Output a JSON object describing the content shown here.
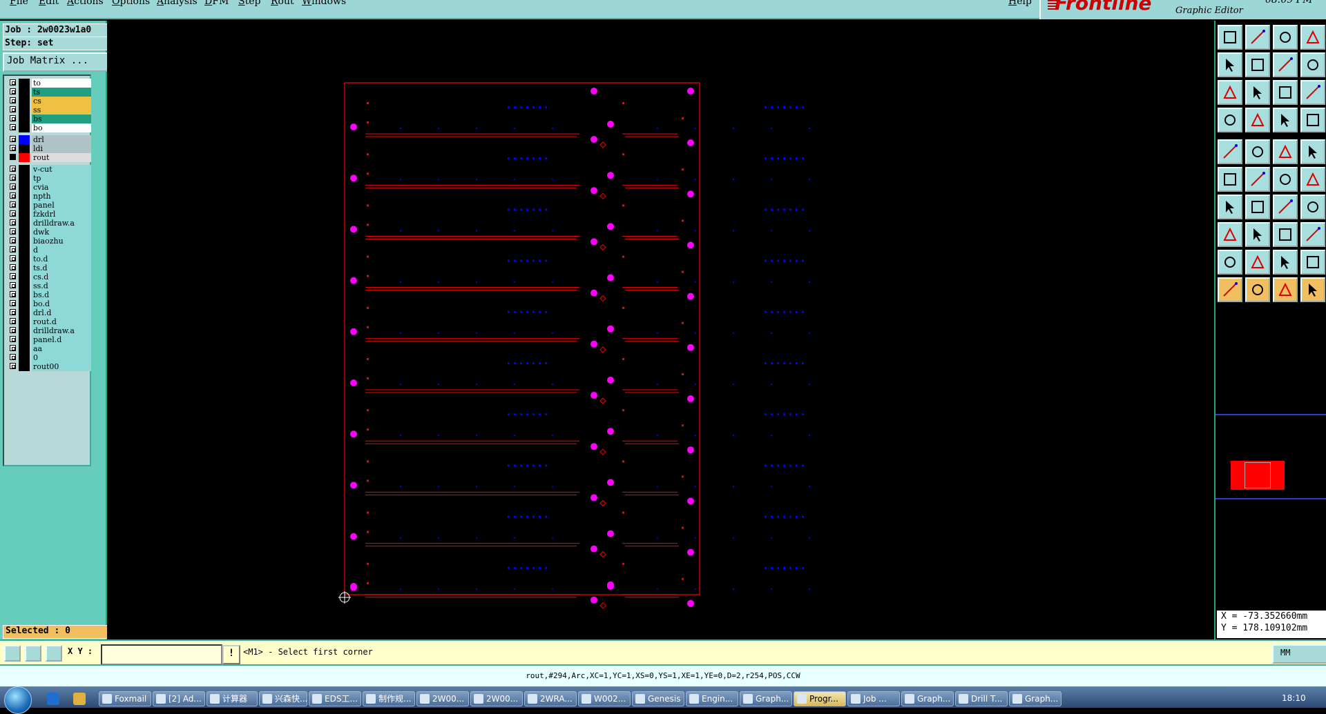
{
  "menubar": {
    "items": [
      "File",
      "Edit",
      "Actions",
      "Options",
      "Analysis",
      "DFM",
      "Step",
      "Rout",
      "Windows"
    ],
    "help": "Help",
    "brand": "Frontline",
    "subtitle": "Graphic Editor",
    "clock": "08:09 PM"
  },
  "left_panel": {
    "job": "Job : 2w0023w1a0",
    "step": "Step: set",
    "job_matrix": "Job Matrix ...",
    "selected": "Selected : 0",
    "layers": [
      {
        "name": "to",
        "bg": "#ffffff"
      },
      {
        "name": "ts",
        "bg": "#20a080"
      },
      {
        "name": "cs",
        "bg": "#f0c040"
      },
      {
        "name": "ss",
        "bg": "#f0c040"
      },
      {
        "name": "bs",
        "bg": "#20a080"
      },
      {
        "name": "bo",
        "bg": "#ffffff"
      },
      {
        "name": "drl",
        "bg": "#b0c4c8",
        "swatch": "#0000ff"
      },
      {
        "name": "ldi",
        "bg": "#b0c4c8"
      },
      {
        "name": "rout",
        "bg": "#dddddd",
        "swatch": "#ff0000",
        "checked": true
      },
      {
        "name": "v-cut",
        "bg": "#8fd8d8"
      },
      {
        "name": "tp",
        "bg": "#8fd8d8"
      },
      {
        "name": "cvia",
        "bg": "#8fd8d8"
      },
      {
        "name": "npth",
        "bg": "#8fd8d8"
      },
      {
        "name": "panel",
        "bg": "#8fd8d8"
      },
      {
        "name": "fzkdrl",
        "bg": "#8fd8d8"
      },
      {
        "name": "drilldraw.a",
        "bg": "#8fd8d8"
      },
      {
        "name": "dwk",
        "bg": "#8fd8d8"
      },
      {
        "name": "biaozhu",
        "bg": "#8fd8d8"
      },
      {
        "name": "d",
        "bg": "#8fd8d8"
      },
      {
        "name": "to.d",
        "bg": "#8fd8d8"
      },
      {
        "name": "ts.d",
        "bg": "#8fd8d8"
      },
      {
        "name": "cs.d",
        "bg": "#8fd8d8"
      },
      {
        "name": "ss.d",
        "bg": "#8fd8d8"
      },
      {
        "name": "bs.d",
        "bg": "#8fd8d8"
      },
      {
        "name": "bo.d",
        "bg": "#8fd8d8"
      },
      {
        "name": "drl.d",
        "bg": "#8fd8d8"
      },
      {
        "name": "rout.d",
        "bg": "#8fd8d8"
      },
      {
        "name": "drilldraw.a",
        "bg": "#8fd8d8"
      },
      {
        "name": "panel.d",
        "bg": "#8fd8d8"
      },
      {
        "name": "aa",
        "bg": "#8fd8d8"
      },
      {
        "name": "0",
        "bg": "#8fd8d8"
      },
      {
        "name": "rout00",
        "bg": "#8fd8d8"
      }
    ]
  },
  "right_panel": {
    "coord_x": "X = -73.352660mm",
    "coord_y": "Y = 178.109102mm"
  },
  "command_bar": {
    "xy_label": "X Y :",
    "xy_value": "",
    "prompt": "<M1> - Select first corner",
    "units": "MM"
  },
  "status_bar": {
    "text": "rout,#294,Arc,XC=1,YC=1,XS=0,YS=1,XE=1,YE=0,D=2,r254,POS,CCW"
  },
  "taskbar": {
    "items": [
      {
        "label": "Foxmail"
      },
      {
        "label": "[2] Ad..."
      },
      {
        "label": "计算器"
      },
      {
        "label": "兴森快..."
      },
      {
        "label": "EDS工..."
      },
      {
        "label": "制作规..."
      },
      {
        "label": "2W00..."
      },
      {
        "label": "2W00..."
      },
      {
        "label": "2WRA..."
      },
      {
        "label": "W002..."
      },
      {
        "label": "Genesis"
      },
      {
        "label": "Engin..."
      },
      {
        "label": "Graph..."
      },
      {
        "label": "Progr...",
        "active": true
      },
      {
        "label": "Job ..."
      },
      {
        "label": "Graph..."
      },
      {
        "label": "Drill T..."
      },
      {
        "label": "Graph..."
      }
    ],
    "time": "18:10"
  },
  "colors": {
    "rout": "#ff0000",
    "drill": "#0000ff",
    "pad": "#ff00ff",
    "menubar": "#9cd6d6"
  }
}
